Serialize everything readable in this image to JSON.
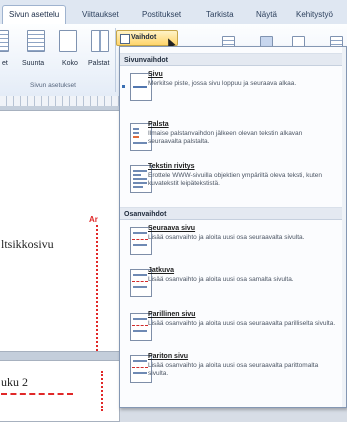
{
  "ribbon": {
    "tabs": [
      "Sivun asettelu",
      "Viittaukset",
      "Postitukset",
      "Tarkista",
      "Näytä",
      "Kehitystyö"
    ],
    "buttons": [
      "Suunta",
      "Koko",
      "Palstat"
    ],
    "left_fragment": "et",
    "group_label": "Sivun asetukset",
    "breaks_button": "Vaihdot"
  },
  "document": {
    "heading_1": "ltsikkosivu",
    "heading_2": "uku 2",
    "break_mark": "Ar"
  },
  "menu": {
    "section_page_breaks": "Sivunvaihdot",
    "section_section_breaks": "Osanvaihdot",
    "items": [
      {
        "title": "Sivu",
        "desc": "Merkitse piste, jossa sivu loppuu ja seuraava alkaa."
      },
      {
        "title": "Palsta",
        "desc": "Ilmaise palstanvaihdon jälkeen olevan tekstin alkavan seuraavalta palstalta."
      },
      {
        "title": "Tekstin rivitys",
        "desc": "Erottele WWW-sivuilla objektien ympäriltä oleva teksti, kuten kuvatekstit leipätekstistä."
      },
      {
        "title": "Seuraava sivu",
        "desc": "Lisää osanvaihto ja aloita uusi osa seuraavalta sivulta."
      },
      {
        "title": "Jatkuva",
        "desc": "Lisää osanvaihto ja aloita uusi osa samalta sivulta."
      },
      {
        "title": "Parillinen sivu",
        "desc": "Lisää osanvaihto ja aloita uusi osa seuraavalta parilliselta sivulta."
      },
      {
        "title": "Pariton sivu",
        "desc": "Lisää osanvaihto ja aloita uusi osa seuraavalta parittomalta sivulta."
      }
    ]
  }
}
